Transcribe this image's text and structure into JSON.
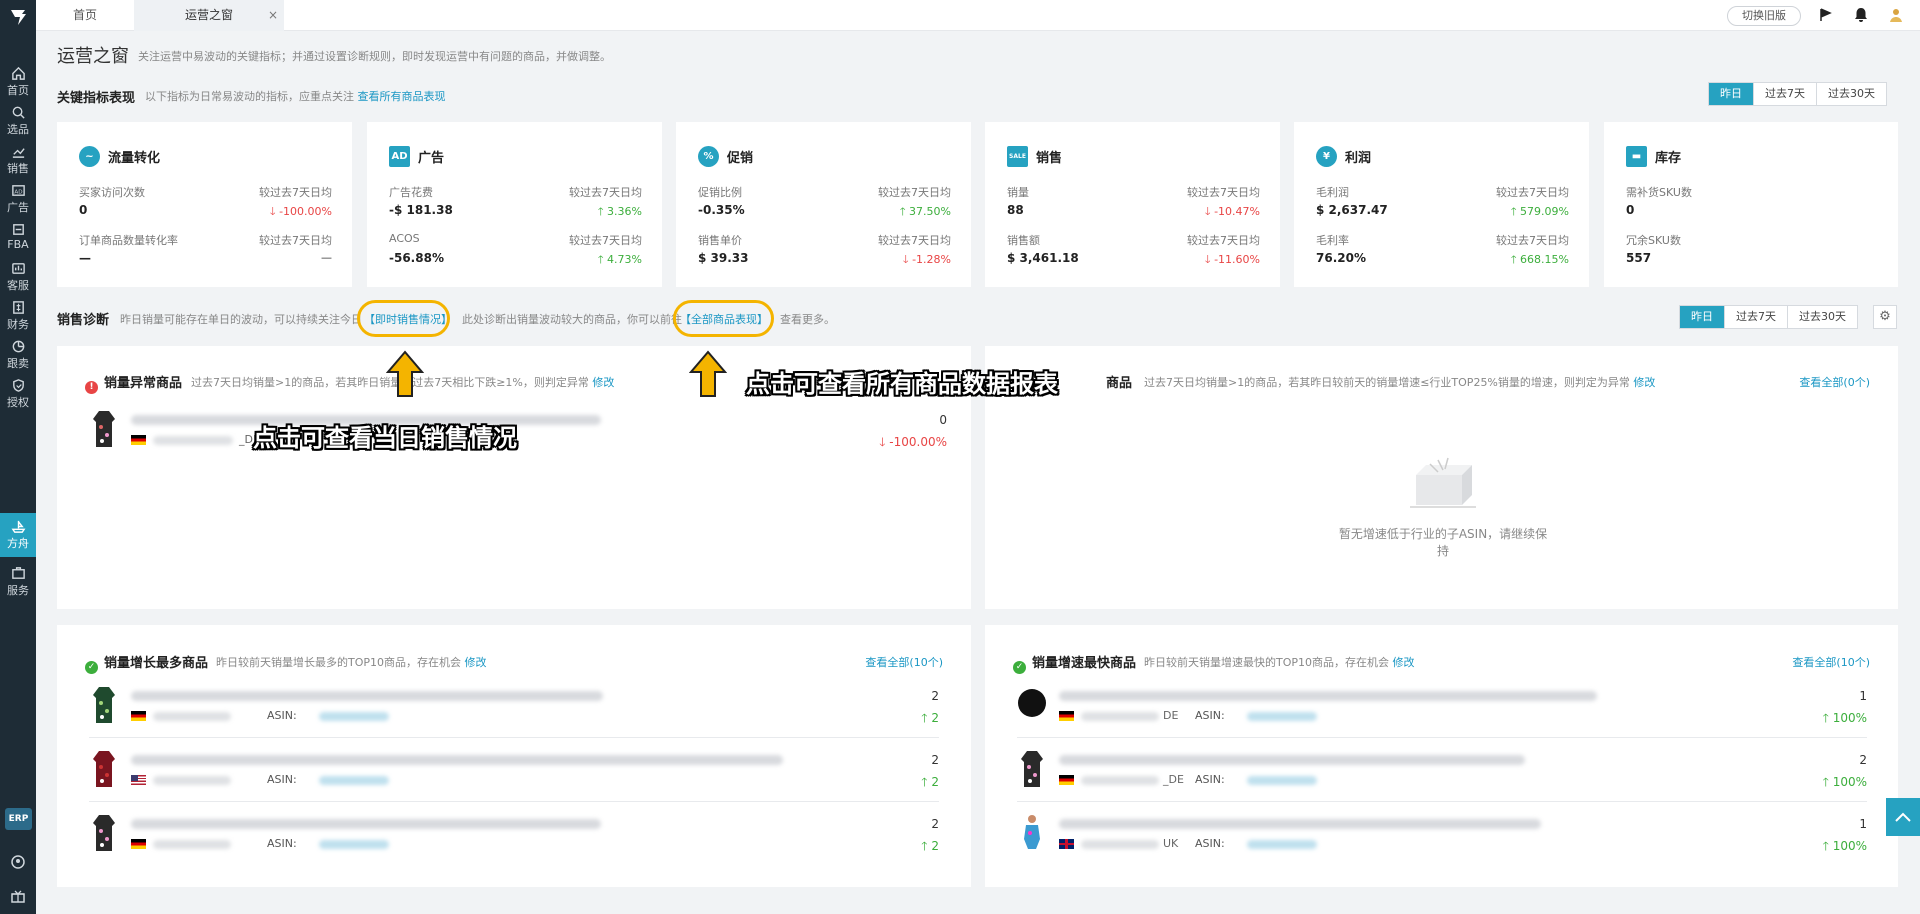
{
  "sidebar": {
    "items": [
      {
        "label": "首页",
        "icon": "home-icon"
      },
      {
        "label": "选品",
        "icon": "search-icon"
      },
      {
        "label": "销售",
        "icon": "chart-icon"
      },
      {
        "label": "广告",
        "icon": "ad-icon"
      },
      {
        "label": "FBA",
        "icon": "fba-icon"
      },
      {
        "label": "客服",
        "icon": "support-icon"
      },
      {
        "label": "财务",
        "icon": "finance-icon"
      },
      {
        "label": "跟卖",
        "icon": "pie-icon"
      },
      {
        "label": "授权",
        "icon": "shield-icon"
      },
      {
        "label": "方舟",
        "icon": "ark-icon"
      },
      {
        "label": "服务",
        "icon": "service-icon"
      }
    ],
    "erp_label": "ERP"
  },
  "tabs": {
    "home": "首页",
    "current": "运营之窗",
    "close": "×"
  },
  "topbar": {
    "old_version": "切换旧版"
  },
  "page": {
    "title": "运营之窗",
    "desc": "关注运营中易波动的关键指标；并通过设置诊断规则，即时发现运营中有问题的商品，并做调整。"
  },
  "kpi_section": {
    "title": "关键指标表现",
    "desc": "以下指标为日常易波动的指标，应重点关注",
    "link": "查看所有商品表现",
    "periods": [
      "昨日",
      "过去7天",
      "过去30天"
    ]
  },
  "kpi_cards": [
    {
      "name": "流量转化",
      "icon": "traffic-icon",
      "icon_text": "~",
      "rows": [
        {
          "label": "买家访问次数",
          "cmp": "较过去7天日均",
          "value": "0",
          "change": "-100.00%",
          "dir": "down"
        },
        {
          "label": "订单商品数量转化率",
          "cmp": "较过去7天日均",
          "value": "—",
          "change": "—",
          "dir": "none"
        }
      ]
    },
    {
      "name": "广告",
      "icon": "ad-icon",
      "icon_text": "AD",
      "rows": [
        {
          "label": "广告花费",
          "cmp": "较过去7天日均",
          "value": "-$ 181.38",
          "change": "3.36%",
          "dir": "up"
        },
        {
          "label": "ACOS",
          "cmp": "较过去7天日均",
          "value": "-56.88%",
          "change": "4.73%",
          "dir": "up"
        }
      ]
    },
    {
      "name": "促销",
      "icon": "promo-icon",
      "icon_text": "%",
      "rows": [
        {
          "label": "促销比例",
          "cmp": "较过去7天日均",
          "value": "-0.35%",
          "change": "37.50%",
          "dir": "up"
        },
        {
          "label": "销售单价",
          "cmp": "较过去7天日均",
          "value": "$ 39.33",
          "change": "-1.28%",
          "dir": "down"
        }
      ]
    },
    {
      "name": "销售",
      "icon": "sale-icon",
      "icon_text": "SALE",
      "rows": [
        {
          "label": "销量",
          "cmp": "较过去7天日均",
          "value": "88",
          "change": "-10.47%",
          "dir": "down"
        },
        {
          "label": "销售额",
          "cmp": "较过去7天日均",
          "value": "$ 3,461.18",
          "change": "-11.60%",
          "dir": "down"
        }
      ]
    },
    {
      "name": "利润",
      "icon": "profit-icon",
      "icon_text": "¥",
      "rows": [
        {
          "label": "毛利润",
          "cmp": "较过去7天日均",
          "value": "$ 2,637.47",
          "change": "579.09%",
          "dir": "up"
        },
        {
          "label": "毛利率",
          "cmp": "较过去7天日均",
          "value": "76.20%",
          "change": "668.15%",
          "dir": "up"
        }
      ]
    },
    {
      "name": "库存",
      "icon": "inventory-icon",
      "icon_text": "▬",
      "rows": [
        {
          "label": "需补货SKU数",
          "cmp": "",
          "value": "0",
          "change": "",
          "dir": "none"
        },
        {
          "label": "冗余SKU数",
          "cmp": "",
          "value": "557",
          "change": "",
          "dir": "none"
        }
      ]
    }
  ],
  "diag_section": {
    "title": "销售诊断",
    "desc_a": "昨日销量可能存在单日的波动，可以持续关注今日",
    "link_a": "【即时销售情况】",
    "desc_b": "此处诊断出销量波动较大的商品，你可以前往",
    "link_b": "【全部商品表现】",
    "desc_c": "查看更多。",
    "periods": [
      "昨日",
      "过去7天",
      "过去30天"
    ]
  },
  "panels": {
    "abnormal": {
      "title": "销量异常商品",
      "desc": "过去7天日均销量>1的商品，若其昨日销量与过去7天相比下跌≥1%，则判定异常",
      "edit": "修改",
      "items": [
        {
          "market": "_DE",
          "value": "0",
          "change": "-100.00%",
          "dir": "down"
        }
      ]
    },
    "slow": {
      "title": "商品",
      "desc": "过去7天日均销量>1的商品，若其昨日较前天的销量增速≤行业TOP25%销量的增速，则判定为异常",
      "edit": "修改",
      "view_all": "查看全部(0个)",
      "empty": "暂无增速低于行业的子ASIN，请继续保持"
    },
    "growth_most": {
      "title": "销量增长最多商品",
      "desc": "昨日较前天销量增长最多的TOP10商品，存在机会",
      "edit": "修改",
      "view_all": "查看全部(10个)",
      "asin_label": "ASIN:",
      "items": [
        {
          "market": "",
          "value": "2",
          "change": "2",
          "flag": "de"
        },
        {
          "market": "",
          "value": "2",
          "change": "2",
          "flag": "us"
        },
        {
          "market": "",
          "value": "2",
          "change": "2",
          "flag": "de"
        }
      ]
    },
    "growth_fast": {
      "title": "销量增速最快商品",
      "desc": "昨日较前天销量增速最快的TOP10商品，存在机会",
      "edit": "修改",
      "view_all": "查看全部(10个)",
      "asin_label": "ASIN:",
      "items": [
        {
          "market": "DE",
          "value": "1",
          "change": "100%",
          "flag": "de"
        },
        {
          "market": "_DE",
          "value": "2",
          "change": "100%",
          "flag": "de"
        },
        {
          "market": "UK",
          "value": "1",
          "change": "100%",
          "flag": "uk"
        }
      ]
    }
  },
  "annotations": {
    "callout_today": "点击可查看当日销售情况",
    "callout_all": "点击可查看所有商品数据报表"
  },
  "colors": {
    "accent": "#26a2c1",
    "up": "#3cae3c",
    "down": "#e84545",
    "highlight": "#f4b400",
    "sidebar": "#1e2c36"
  }
}
